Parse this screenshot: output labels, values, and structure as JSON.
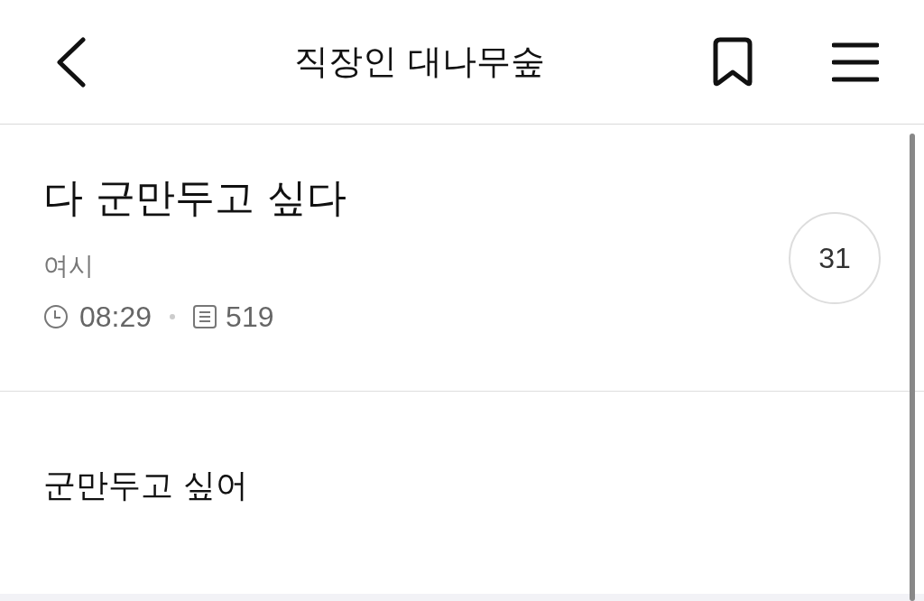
{
  "header": {
    "title": "직장인 대나무숲"
  },
  "post": {
    "title": "다 군만두고 싶다",
    "author": "여시",
    "time": "08:29",
    "views": "519",
    "comment_count": "31"
  },
  "body": {
    "text": "군만두고 싶어"
  }
}
